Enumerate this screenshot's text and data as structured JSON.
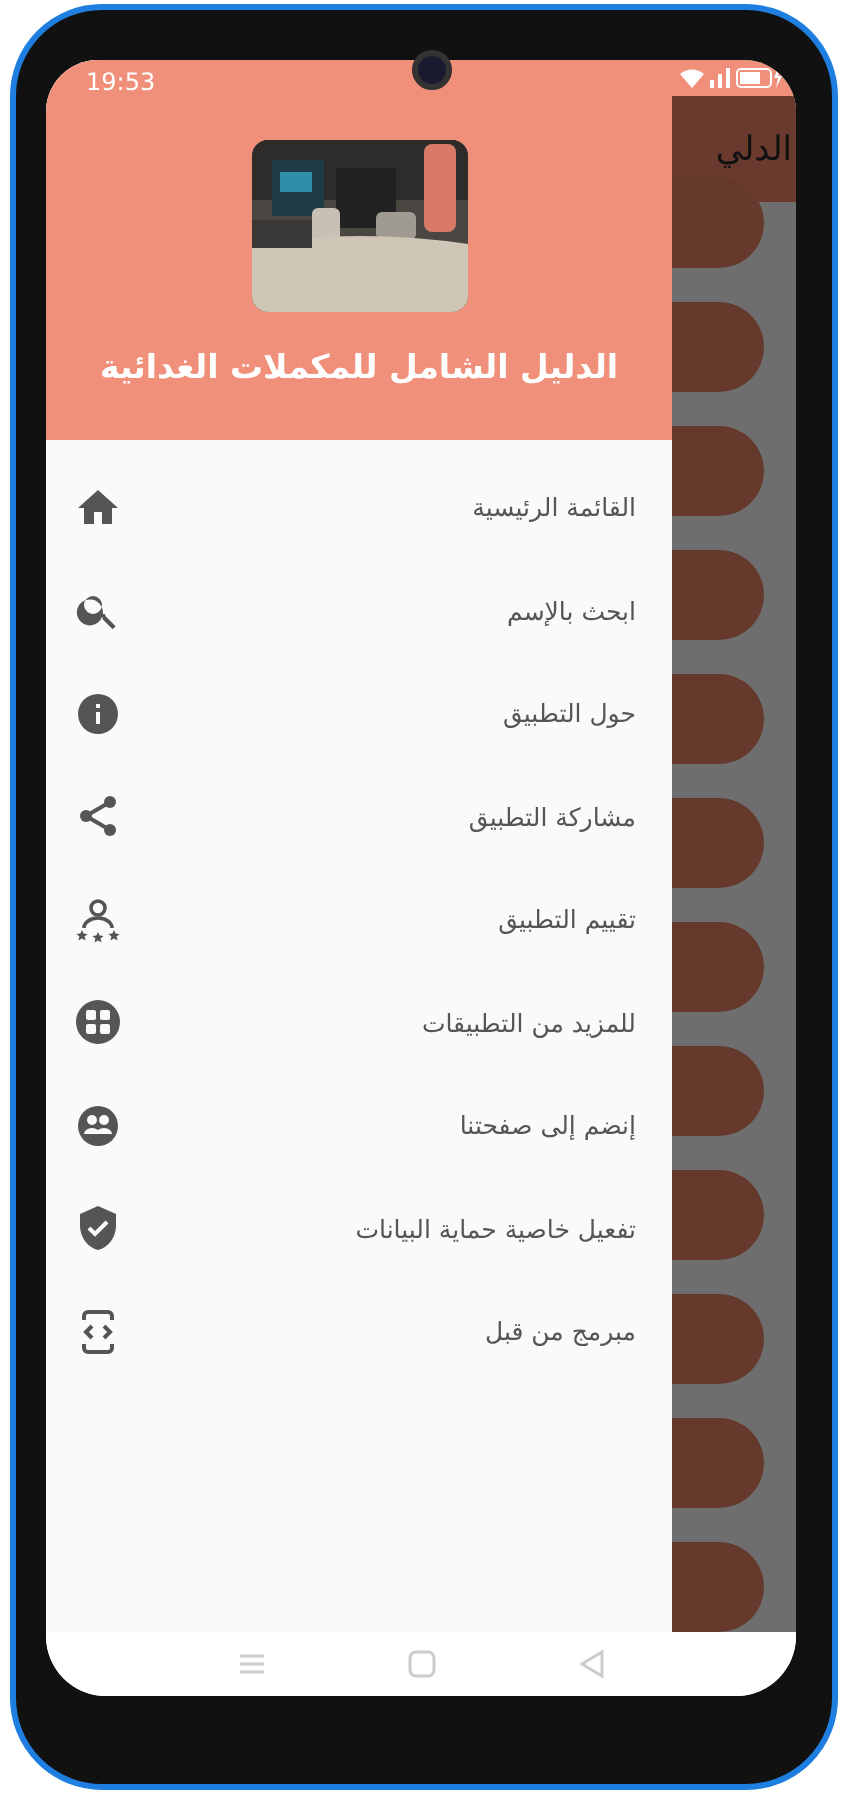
{
  "status_bar": {
    "time": "19:53"
  },
  "drawer": {
    "header": {
      "title": "الدليل الشامل للمكملات الغدائية"
    },
    "items": [
      {
        "label": "القائمة الرئيسية"
      },
      {
        "label": "ابحث بالإسم"
      },
      {
        "label": "حول التطبيق"
      },
      {
        "label": "مشاركة التطبيق"
      },
      {
        "label": "تقييم التطبيق"
      },
      {
        "label": "للمزيد من التطبيقات"
      },
      {
        "label": "إنضم إلى صفحتنا"
      },
      {
        "label": "تفعيل خاصية حماية البيانات"
      },
      {
        "label": "مبرمج من قبل"
      }
    ]
  },
  "app_bar": {
    "title": "الدلي"
  }
}
